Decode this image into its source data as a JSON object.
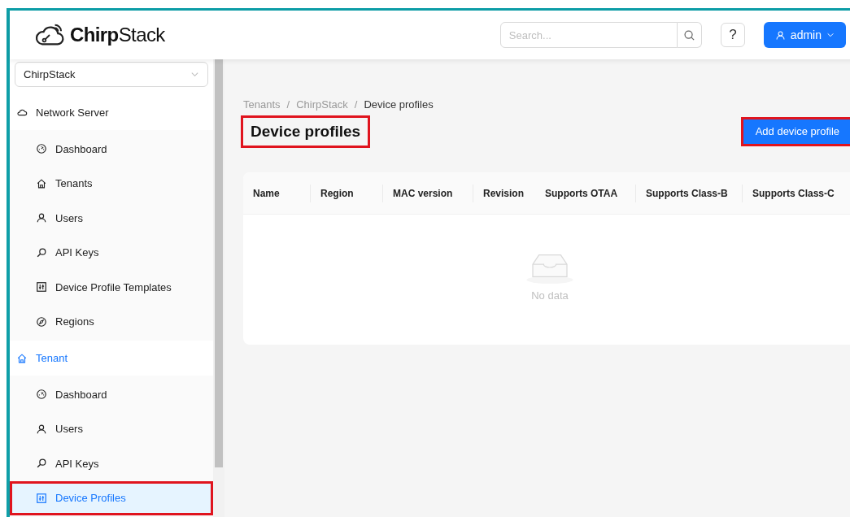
{
  "header": {
    "logo": {
      "bold": "Chirp",
      "regular": "Stack"
    },
    "search": {
      "placeholder": "Search..."
    },
    "help_button": "?",
    "user_button": "admin"
  },
  "sidebar": {
    "tenant_select": "ChirpStack",
    "sections": [
      {
        "title": "Network Server",
        "selected": false,
        "items": [
          {
            "label": "Dashboard",
            "selected": false
          },
          {
            "label": "Tenants",
            "selected": false
          },
          {
            "label": "Users",
            "selected": false
          },
          {
            "label": "API Keys",
            "selected": false
          },
          {
            "label": "Device Profile Templates",
            "selected": false
          },
          {
            "label": "Regions",
            "selected": false
          }
        ]
      },
      {
        "title": "Tenant",
        "selected": true,
        "items": [
          {
            "label": "Dashboard",
            "selected": false
          },
          {
            "label": "Users",
            "selected": false
          },
          {
            "label": "API Keys",
            "selected": false
          },
          {
            "label": "Device Profiles",
            "selected": true,
            "highlighted": true
          }
        ]
      }
    ]
  },
  "breadcrumb": [
    "Tenants",
    "ChirpStack",
    "Device profiles"
  ],
  "breadcrumb_separator": "/",
  "page_title": {
    "text": "Device profiles",
    "highlighted": true
  },
  "add_button": {
    "label": "Add device profile",
    "highlighted": true
  },
  "table": {
    "columns": [
      "Name",
      "Region",
      "MAC version",
      "Revision",
      "Supports OTAA",
      "Supports Class-B",
      "Supports Class-C"
    ],
    "empty_text": "No data"
  }
}
